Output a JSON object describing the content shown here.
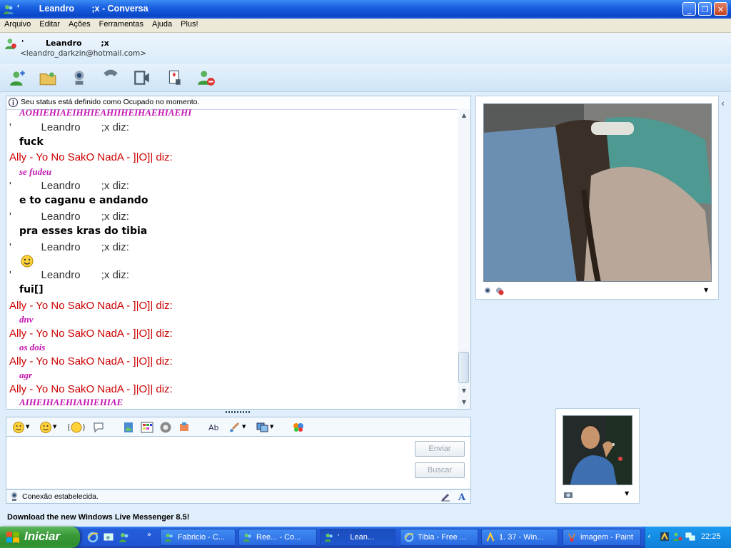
{
  "window": {
    "title": "'        Leandro       ;x - Conversa"
  },
  "menu": [
    "Arquivo",
    "Editar",
    "Ações",
    "Ferramentas",
    "Ajuda",
    "Plus!"
  ],
  "contact": {
    "name": "'        Leandro       ;x",
    "email": "<leandro_darkzin@hotmail.com>"
  },
  "status_notice": "Seu status está definido como Ocupado no momento.",
  "messages": [
    {
      "kind": "msg-top",
      "text": "AOHIEHIAEIHHIEAHIIHEIHAEHIAEHI"
    },
    {
      "kind": "hdr-self",
      "text": "'          Leandro       ;x diz:"
    },
    {
      "kind": "msg-self",
      "text": "fuck"
    },
    {
      "kind": "hdr-other",
      "text": "Ally - Yo No SakO NadA - ]|O]| diz:"
    },
    {
      "kind": "msg-other",
      "text": "se fudeu"
    },
    {
      "kind": "hdr-self",
      "text": "'          Leandro       ;x diz:"
    },
    {
      "kind": "msg-self",
      "text": "e to caganu e andando"
    },
    {
      "kind": "hdr-self",
      "text": "'          Leandro       ;x diz:"
    },
    {
      "kind": "msg-self",
      "text": "pra esses kras do tibia"
    },
    {
      "kind": "hdr-self",
      "text": "'          Leandro       ;x diz:"
    },
    {
      "kind": "emoticon",
      "text": ""
    },
    {
      "kind": "hdr-self",
      "text": "'          Leandro       ;x diz:"
    },
    {
      "kind": "msg-self",
      "text": "fui[]"
    },
    {
      "kind": "hdr-other",
      "text": "Ally - Yo No SakO NadA - ]|O]| diz:"
    },
    {
      "kind": "msg-other",
      "text": "dnv"
    },
    {
      "kind": "hdr-other",
      "text": "Ally - Yo No SakO NadA - ]|O]| diz:"
    },
    {
      "kind": "msg-other",
      "text": "os dois"
    },
    {
      "kind": "hdr-other",
      "text": "Ally - Yo No SakO NadA - ]|O]| diz:"
    },
    {
      "kind": "msg-other",
      "text": "agr"
    },
    {
      "kind": "hdr-other",
      "text": "Ally - Yo No SakO NadA - ]|O]| diz:"
    },
    {
      "kind": "msg-top",
      "text": "AIHEIHAEHIAHIEHIAE"
    }
  ],
  "buttons": {
    "send": "Enviar",
    "search": "Buscar"
  },
  "connection_status": "Conexão estabelecida.",
  "ad_banner": "Download the new Windows Live Messenger 8.5!",
  "taskbar": {
    "start": "Iniciar",
    "tasks": [
      "Fabricio - C...",
      "Ree... - Co...",
      "'     Lean...",
      "Tibia - Free ...",
      "1. 37 - Win...",
      "imagem - Paint"
    ],
    "clock": "22:25"
  },
  "colors": {
    "accent": "#1a5fe0",
    "other_user": "#cc0000",
    "other_msg": "#c414b0"
  }
}
